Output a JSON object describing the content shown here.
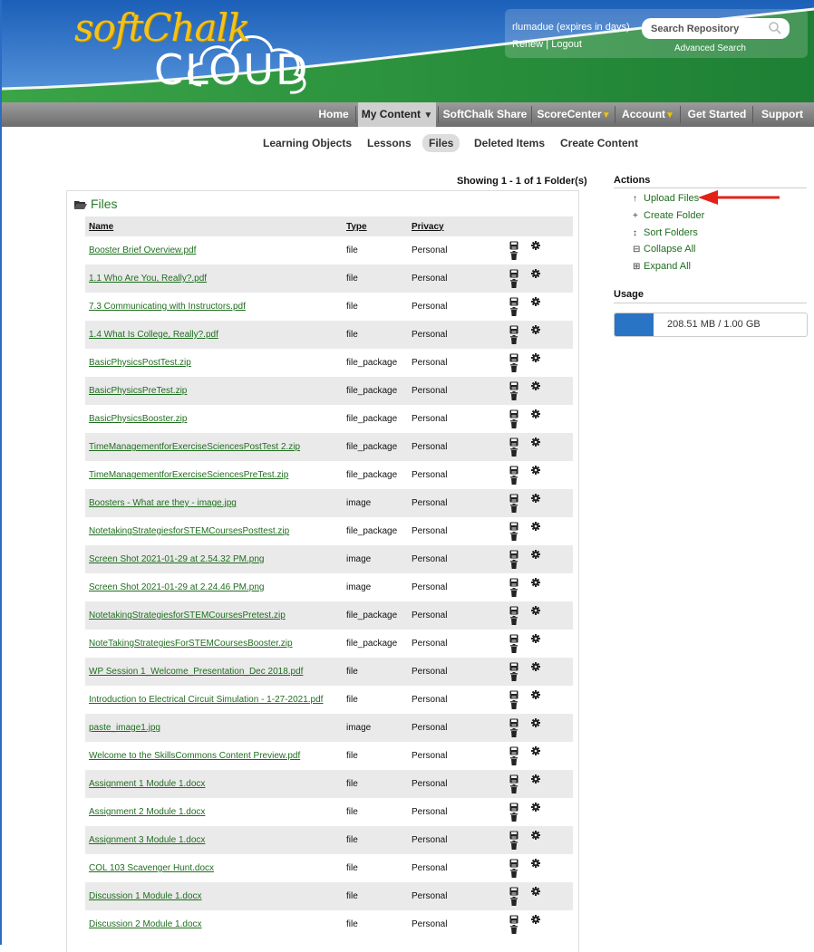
{
  "header": {
    "logo_top": "softChalk",
    "logo_bottom": "CLOUD",
    "username": "rlumadue (expires in days)",
    "renew": "Renew",
    "logout": "Logout",
    "separator": " | ",
    "search_placeholder": "Search Repository",
    "advanced_search": "Advanced Search"
  },
  "nav": {
    "home": "Home",
    "my_content": "My Content",
    "softchalk_share": "SoftChalk Share",
    "scorecenter": "ScoreCenter",
    "account": "Account",
    "get_started": "Get Started",
    "support": "Support",
    "dropdown_glyph": "▼"
  },
  "subnav": {
    "learning_objects": "Learning Objects",
    "lessons": "Lessons",
    "files": "Files",
    "deleted_items": "Deleted Items",
    "create_content": "Create Content"
  },
  "showing": "Showing 1 - 1 of 1 Folder(s)",
  "panel": {
    "title": "Files",
    "columns": {
      "name": "Name",
      "type": "Type",
      "privacy": "Privacy"
    },
    "rows": [
      {
        "name": "Booster Brief Overview.pdf",
        "type": "file",
        "privacy": "Personal"
      },
      {
        "name": "1.1 Who Are You, Really?.pdf",
        "type": "file",
        "privacy": "Personal"
      },
      {
        "name": "7.3 Communicating with Instructors.pdf",
        "type": "file",
        "privacy": "Personal"
      },
      {
        "name": "1.4 What Is College, Really?.pdf",
        "type": "file",
        "privacy": "Personal"
      },
      {
        "name": "BasicPhysicsPostTest.zip",
        "type": "file_package",
        "privacy": "Personal"
      },
      {
        "name": "BasicPhysicsPreTest.zip",
        "type": "file_package",
        "privacy": "Personal"
      },
      {
        "name": "BasicPhysicsBooster.zip",
        "type": "file_package",
        "privacy": "Personal"
      },
      {
        "name": "TimeManagementforExerciseSciencesPostTest 2.zip",
        "type": "file_package",
        "privacy": "Personal"
      },
      {
        "name": "TimeManagementforExerciseSciencesPreTest.zip",
        "type": "file_package",
        "privacy": "Personal"
      },
      {
        "name": "Boosters - What are they - image.jpg",
        "type": "image",
        "privacy": "Personal"
      },
      {
        "name": "NotetakingStrategiesforSTEMCoursesPosttest.zip",
        "type": "file_package",
        "privacy": "Personal"
      },
      {
        "name": "Screen Shot 2021-01-29 at 2.54.32 PM.png",
        "type": "image",
        "privacy": "Personal"
      },
      {
        "name": "Screen Shot 2021-01-29 at 2.24.46 PM.png",
        "type": "image",
        "privacy": "Personal"
      },
      {
        "name": "NotetakingStrategiesforSTEMCoursesPretest.zip",
        "type": "file_package",
        "privacy": "Personal"
      },
      {
        "name": "NoteTakingStrategiesForSTEMCoursesBooster.zip",
        "type": "file_package",
        "privacy": "Personal"
      },
      {
        "name": "WP Session 1_Welcome_Presentation_Dec 2018.pdf",
        "type": "file",
        "privacy": "Personal"
      },
      {
        "name": "Introduction to Electrical Circuit Simulation - 1-27-2021.pdf",
        "type": "file",
        "privacy": "Personal"
      },
      {
        "name": "paste_image1.jpg",
        "type": "image",
        "privacy": "Personal"
      },
      {
        "name": "Welcome to the SkillsCommons Content Preview.pdf",
        "type": "file",
        "privacy": "Personal"
      },
      {
        "name": "Assignment 1 Module 1.docx",
        "type": "file",
        "privacy": "Personal"
      },
      {
        "name": "Assignment 2 Module 1.docx",
        "type": "file",
        "privacy": "Personal"
      },
      {
        "name": "Assignment 3 Module 1.docx",
        "type": "file",
        "privacy": "Personal"
      },
      {
        "name": "COL 103 Scavenger Hunt.docx",
        "type": "file",
        "privacy": "Personal"
      },
      {
        "name": "Discussion 1 Module 1.docx",
        "type": "file",
        "privacy": "Personal"
      },
      {
        "name": "Discussion 2 Module 1.docx",
        "type": "file",
        "privacy": "Personal"
      }
    ],
    "row_icons": [
      "save-icon",
      "gear-icon",
      "trash-icon"
    ]
  },
  "actions": {
    "heading": "Actions",
    "upload": "Upload Files",
    "create_folder": "Create Folder",
    "sort_folders": "Sort Folders",
    "collapse_all": "Collapse All",
    "expand_all": "Expand All"
  },
  "usage": {
    "heading": "Usage",
    "text": "208.51 MB / 1.00 GB",
    "fraction": 0.204
  },
  "colors": {
    "link_green": "#1f6e1f",
    "nav_gray": "#7d7d7d",
    "usage_blue": "#2a74c6",
    "annotation_red": "#e32119"
  }
}
